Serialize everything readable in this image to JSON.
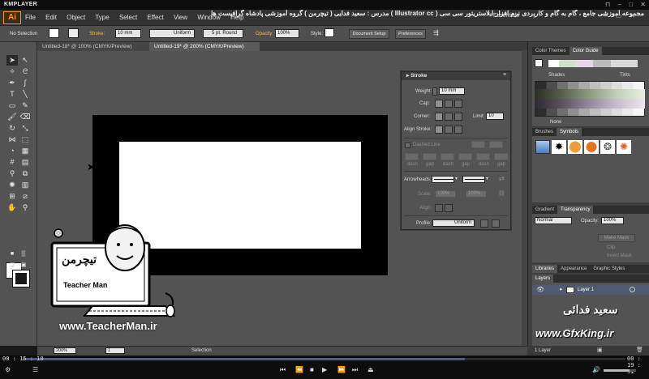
{
  "player": {
    "title": "KMPLAYER",
    "time_current": "00 : 15 : 10",
    "time_total": "00 : 19 : 51",
    "progress": 0.735
  },
  "course_banner": "مجموعه آموزشی جامع ، گام به گام و کاربردی نرم افزار ایلاستریتور سی سی ( Illustrator cc )   مدرس : سعید فدایی ( تیچرمن ) گروه آموزشی پادشاه گرافیست ها",
  "menubar": {
    "logo": "Ai",
    "items": [
      "File",
      "Edit",
      "Object",
      "Type",
      "Select",
      "Effect",
      "View",
      "Window",
      "Help"
    ],
    "workspace": "Essentials"
  },
  "control_bar": {
    "selection_label": "No Selection",
    "stroke_label": "Stroke:",
    "stroke_weight": "10 mm",
    "profile": "Uniform",
    "brush": "5 pt. Round",
    "opacity_label": "Opacity:",
    "opacity_value": "100%",
    "style_label": "Style:",
    "doc_setup": "Document Setup",
    "preferences": "Preferences"
  },
  "tabs": [
    {
      "label": "Untitled-18* @ 100% (CMYK/Preview)",
      "active": false
    },
    {
      "label": "Untitled-19* @ 200% (CMYK/Preview)",
      "active": true
    }
  ],
  "stroke_panel": {
    "title": "Stroke",
    "weight_label": "Weight:",
    "weight_value": "10 mm",
    "cap_label": "Cap:",
    "corner_label": "Corner:",
    "limit_label": "Limit:",
    "limit_value": "10",
    "align_label": "Align Stroke:",
    "dashed_label": "Dashed Line",
    "dash_labels": [
      "dash",
      "gap",
      "dash",
      "gap",
      "dash",
      "gap"
    ],
    "arrowheads_label": "Arrowheads:",
    "scale_label": "Scale:",
    "scale_values": [
      "100%",
      "100%"
    ],
    "align_arrow_label": "Align:",
    "profile_label": "Profile:",
    "profile_value": "Uniform"
  },
  "right_panels": {
    "color_tabs": [
      "Color Themes",
      "Color Guide"
    ],
    "shades_label": "Shades",
    "tints_label": "Tints",
    "none_label": "None",
    "brush_tabs": [
      "Brushes",
      "Symbols"
    ],
    "gradient_tabs": [
      "Gradient",
      "Transparency"
    ],
    "blend_mode": "Normal",
    "opacity_label": "Opacity:",
    "opacity_value": "100%",
    "make_mask": "Make Mask",
    "clip_label": "Clip",
    "invert_label": "Invert Mask",
    "lib_tabs": [
      "Libraries",
      "Appearance",
      "Graphic Styles"
    ],
    "layers_tab": "Layers",
    "layer_name": "Layer 1",
    "layer_count": "1 Layer"
  },
  "status_bar": {
    "zoom": "200%",
    "page": "1",
    "mode": "Selection"
  },
  "watermark": {
    "site_left": "www.TeacherMan.ir",
    "logo_text": "تیچرمن",
    "logo_en": "Teacher Man",
    "name_fa": "سعید فدائی",
    "site_right": "www.GfxKing.ir"
  },
  "colors": {
    "ai_orange": "#ff9a00",
    "panel_gray": "#535353",
    "seek_fill": "#4e5d7c"
  }
}
